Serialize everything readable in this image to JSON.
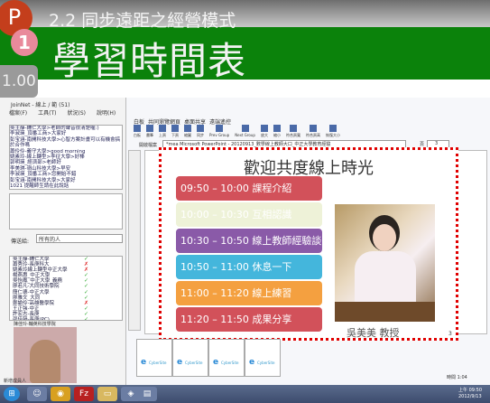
{
  "header": {
    "subtitle": "2.2 同步遠距之經營模式",
    "title": "學習時間表",
    "app_logo": "P",
    "slide_number_badge": "1",
    "zoom_level": "1.00"
  },
  "left_panel": {
    "window_title": "JoinNet - 線上 / 範 (51)",
    "menu": [
      "檔案(F)",
      "工具(T)",
      "狀況(S)",
      "說明(H)"
    ],
    "chat_lines": [
      "吳主靜-輔仁大學>老師的聲音很清楚喔:)",
      "李淑瑛_頂番工商>大家好",
      "彭宝涵-南開科技大學>心智方案計畫可以有機會搞",
      "於合作嗎",
      "蕭伶伶-義守大學>good morning",
      "姚素玲-線上轉型>李征大學>好棒",
      "郭明瑛_經濟部>老師好",
      "李美琪-嶺山科技大學>早安",
      "李淑瑛_頂番工商>您開始不錯",
      "彭宝涵-南開科技大學>大家好",
      "1021 提醒師生請在此說話"
    ],
    "send_to_label": "傳送給:",
    "send_to_value": "所有的人",
    "users": [
      {
        "name": "吳主靜-輔仁大學",
        "status": "✓"
      },
      {
        "name": "蕭秀玲-長庚科大",
        "status": "✗"
      },
      {
        "name": "姚素玲線上轉型中正大學",
        "status": "✗"
      },
      {
        "name": "楊燕惠_中正大學",
        "status": "✓"
      },
      {
        "name": "吳怡鳳_中正大學_義務",
        "status": "✓"
      },
      {
        "name": "廖若凡-大同技術學院",
        "status": "✓"
      },
      {
        "name": "簡仁德-中正大學",
        "status": "✓"
      },
      {
        "name": "廖雅文_大同",
        "status": "✓"
      },
      {
        "name": "鄭諭伶-高雄醫學院",
        "status": "✗"
      },
      {
        "name": "王正強-中正",
        "status": "✓"
      },
      {
        "name": "許宏志-長庚",
        "status": "✓"
      },
      {
        "name": "邵佳韻-長庚(PC)",
        "status": "✓"
      },
      {
        "name": "Teresa",
        "status": "✗"
      },
      {
        "name": "謝碧霞_長庚科大",
        "status": "✗"
      },
      {
        "name": "李淑瑛_頂番工商",
        "status": "✓"
      },
      {
        "name": "陳佳玲-輔英科技學院",
        "status": "✓"
      }
    ],
    "video_label": "陳佳玲-輔英科技學院",
    "status_text": "新增成員人"
  },
  "right_panel": {
    "tabs": [
      "白板",
      "共同瀏覽網頁",
      "桌面共享",
      "遠端遙控"
    ],
    "tools": [
      "白板",
      "畫筆",
      "上頁",
      "下頁",
      "縮圖",
      "同步",
      "Prev Group",
      "Next Group",
      "放大",
      "縮小",
      "符合頁寬",
      "符合頁高",
      "恢復大小"
    ],
    "doc_label": "開啟檔案",
    "doc_value": "*mea Microsoft PowerPoint - 20120913_數學線上教師大口_中正大學教育經驗",
    "page_label": "頁",
    "page_value": "3",
    "thumbs": [
      "CyberSite",
      "CyberSite",
      "CyberSite",
      "CyberSite"
    ],
    "time_label": "時間 1:04"
  },
  "slide": {
    "title": "歡迎共度線上時光",
    "page": "3",
    "caption": "吳美美  教授",
    "schedule": [
      {
        "text": "09:50 – 10:00  課程介紹",
        "color": "#d2515a"
      },
      {
        "text": "10:00 – 10:30  互相認識",
        "color": "#eef2d8"
      },
      {
        "text": "10:30 – 10:50   線上教師經驗談",
        "color": "#8a5aa8"
      },
      {
        "text": "10:50 – 11:00  休息一下",
        "color": "#44b6dc"
      },
      {
        "text": "11:00 – 11:20  線上練習",
        "color": "#f4a040"
      },
      {
        "text": "11:20 – 11:50  成果分享",
        "color": "#d2515a"
      }
    ]
  },
  "taskbar": {
    "clock": "上午 09:50",
    "date": "2012/9/13"
  }
}
